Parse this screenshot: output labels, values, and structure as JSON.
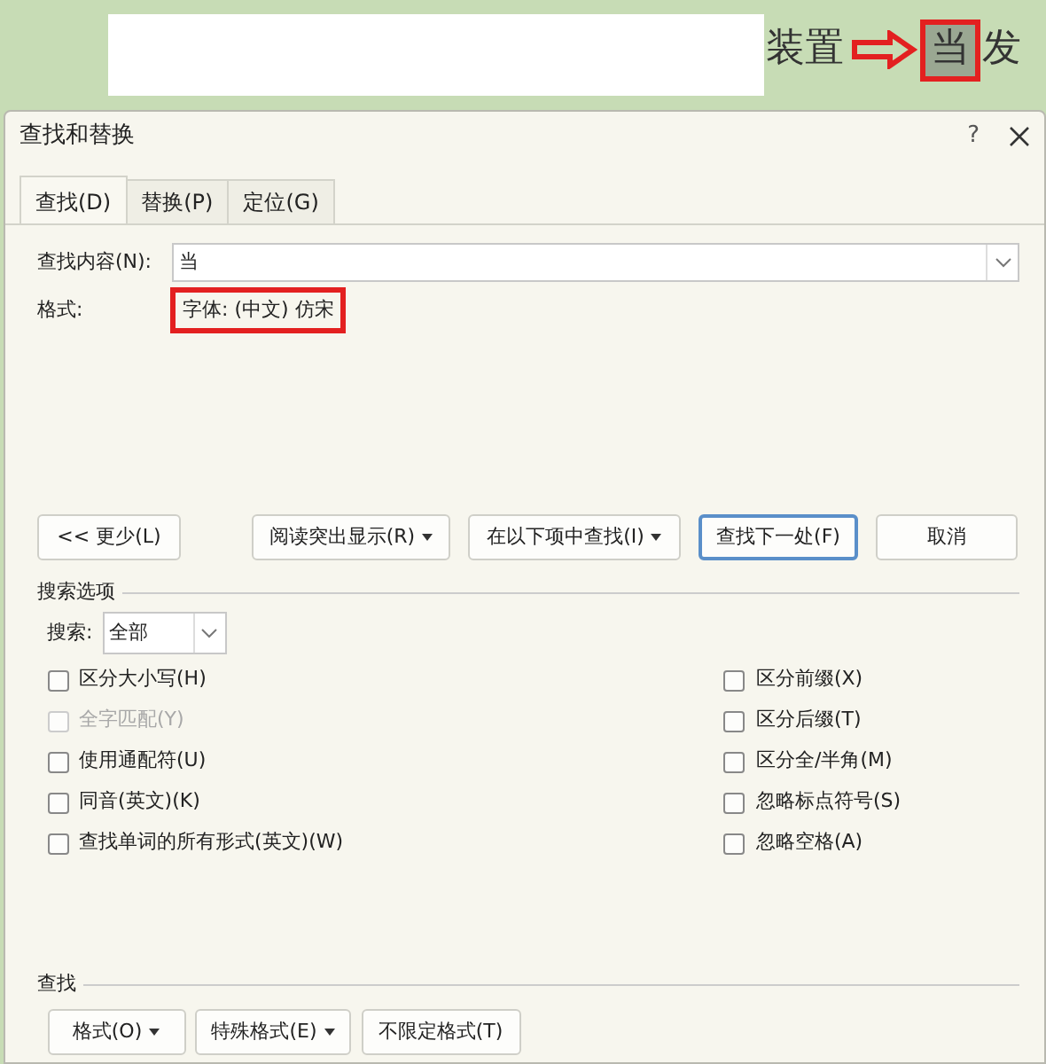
{
  "document": {
    "before": "装置",
    "match": "当",
    "after": "发"
  },
  "dialog": {
    "title": "查找和替换",
    "help": "?"
  },
  "tabs": [
    {
      "label": "查找(D)",
      "selected": true
    },
    {
      "label": "替换(P)",
      "selected": false
    },
    {
      "label": "定位(G)",
      "selected": false
    }
  ],
  "find_what": {
    "label": "查找内容(N):",
    "value": "当"
  },
  "format": {
    "label": "格式:",
    "value": "字体: (中文) 仿宋"
  },
  "buttons": [
    {
      "label": "<< 更少(L)",
      "dropdown": false,
      "default": false
    },
    {
      "label": "阅读突出显示(R)",
      "dropdown": true,
      "default": false
    },
    {
      "label": "在以下项中查找(I)",
      "dropdown": true,
      "default": false
    },
    {
      "label": "查找下一处(F)",
      "dropdown": false,
      "default": true
    },
    {
      "label": "取消",
      "dropdown": false,
      "default": false
    }
  ],
  "search_options": {
    "title": "搜索选项",
    "search_label": "搜索:",
    "search_value": "全部",
    "left": [
      {
        "label": "区分大小写(H)",
        "checked": false,
        "disabled": false
      },
      {
        "label": "全字匹配(Y)",
        "checked": false,
        "disabled": true
      },
      {
        "label": "使用通配符(U)",
        "checked": false,
        "disabled": false
      },
      {
        "label": "同音(英文)(K)",
        "checked": false,
        "disabled": false
      },
      {
        "label": "查找单词的所有形式(英文)(W)",
        "checked": false,
        "disabled": false
      }
    ],
    "right": [
      {
        "label": "区分前缀(X)",
        "checked": false,
        "disabled": false
      },
      {
        "label": "区分后缀(T)",
        "checked": false,
        "disabled": false
      },
      {
        "label": "区分全/半角(M)",
        "checked": false,
        "disabled": false
      },
      {
        "label": "忽略标点符号(S)",
        "checked": false,
        "disabled": false
      },
      {
        "label": "忽略空格(A)",
        "checked": false,
        "disabled": false
      }
    ]
  },
  "find_section": {
    "title": "查找",
    "buttons": [
      {
        "label": "格式(O)",
        "dropdown": true
      },
      {
        "label": "特殊格式(E)",
        "dropdown": true
      },
      {
        "label": "不限定格式(T)",
        "dropdown": false
      }
    ]
  }
}
